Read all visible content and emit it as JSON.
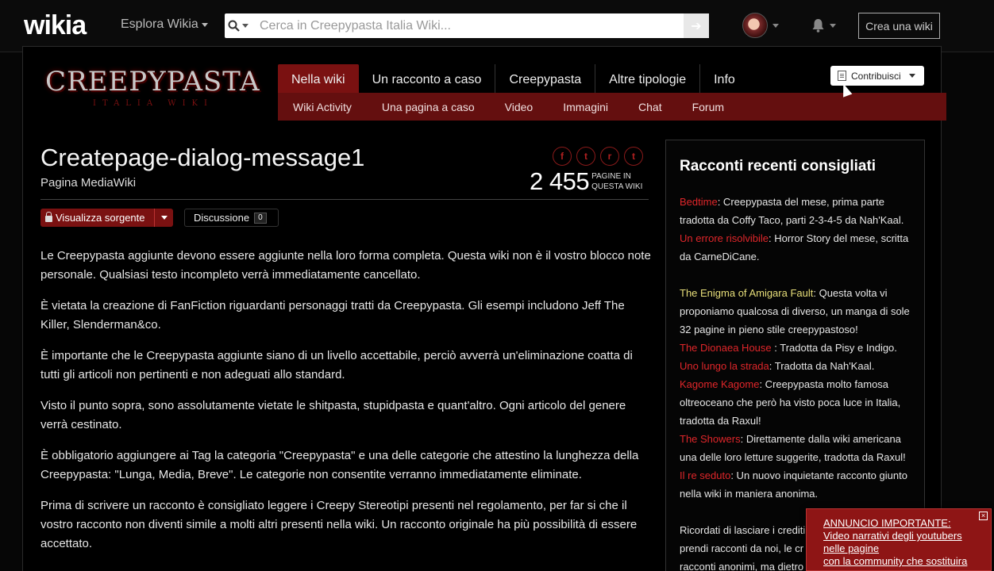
{
  "global_nav": {
    "logo": "wikia",
    "explore_label": "Esplora Wikia",
    "search_placeholder": "Cerca in Creepypasta Italia Wiki...",
    "create_wiki_label": "Crea una wiki"
  },
  "wiki": {
    "logo_text": "CREEPYPASTA",
    "logo_subtext": "ITALIA WIKI",
    "tabs": [
      "Nella wiki",
      "Un racconto a caso",
      "Creepypasta",
      "Altre tipologie",
      "Info"
    ],
    "subnav": [
      "Wiki Activity",
      "Una pagina a caso",
      "Video",
      "Immagini",
      "Chat",
      "Forum"
    ],
    "contribute_label": "Contribuisci"
  },
  "header": {
    "title": "Createpage-dialog-message1",
    "subtitle": "Pagina MediaWiki",
    "page_count": "2 455",
    "page_count_label_1": "PAGINE IN",
    "page_count_label_2": "QUESTA WIKI",
    "view_source_label": "Visualizza sorgente",
    "discussion_label": "Discussione",
    "discussion_count": "0"
  },
  "article": {
    "paragraphs": [
      "Le Creepypasta aggiunte devono essere aggiunte nella loro forma completa. Questa wiki non è il vostro blocco note personale. Qualsiasi testo incompleto verrà immediatamente cancellato.",
      "È vietata la creazione di FanFiction riguardanti personaggi tratti da Creepypasta. Gli esempi includono Jeff The Killer, Slenderman&co.",
      "È importante che le Creepypasta aggiunte siano di un livello accettabile, perciò avverrà un'eliminazione coatta di tutti gli articoli non pertinenti e non adeguati allo standard.",
      "Visto il punto sopra, sono assolutamente vietate le shitpasta, stupidpasta e quant'altro. Ogni articolo del genere verrà cestinato.",
      "È obbligatorio aggiungere ai Tag la categoria \"Creepypasta\" e una delle categorie che attestino la lunghezza della Creepypasta: \"Lunga, Media, Breve\". Le categorie non consentite verranno immediatamente eliminate.",
      "Prima di scrivere un racconto è consigliato leggere i Creepy Stereotipi presenti nel regolamento, per far si che il vostro racconto non diventi simile a molti altri presenti nella wiki. Un racconto originale ha più possibilità di essere accettato."
    ]
  },
  "rail": {
    "title": "Racconti recenti consigliati",
    "entries": [
      {
        "link": "Bedtime",
        "text": ": Creepypasta del mese, prima parte tradotta da Coffy Taco, parti 2-3-4-5 da Nah'Kaal."
      },
      {
        "link": "Un errore risolvibile",
        "text": ": Horror Story del mese, scritta da CarneDiCane."
      },
      {
        "link": "The Enigma of Amigara Fault",
        "text": ": Questa volta vi proponiamo qualcosa di diverso, un manga di sole 32 pagine in pieno stile creepypastoso!"
      },
      {
        "link": "The Dionaea House",
        "text": " : Tradotta da Pisy e Indigo."
      },
      {
        "link": "Uno lungo la strada",
        "text": ": Tradotta da Nah'Kaal."
      },
      {
        "link": "Kagome Kagome",
        "text": ": Creepypasta molto famosa oltreoceano che però ha visto poca luce in Italia, tradotta da Raxul!"
      },
      {
        "link": "The Showers",
        "text": ": Direttamente dalla wiki americana una delle loro letture suggerite, tradotta da Raxul!"
      },
      {
        "link": "Il re seduto",
        "text": ": Un nuovo inquietante racconto giunto nella wiki in maniera anonima."
      }
    ],
    "footer_lines": [
      "Ricordati di lasciare i crediti",
      "prendi racconti da noi, le cr",
      "racconti anonimi, ma dietro"
    ]
  },
  "announcement": {
    "line1": "ANNUNCIO IMPORTANTE:",
    "line2": "Video narrativi degli youtubers",
    "line3": "nelle pagine",
    "line4": "con la community che sostituira"
  },
  "colors": {
    "accent_red": "#7a1111",
    "link_red": "#e0262a",
    "link_yellow": "#e8df7a"
  }
}
